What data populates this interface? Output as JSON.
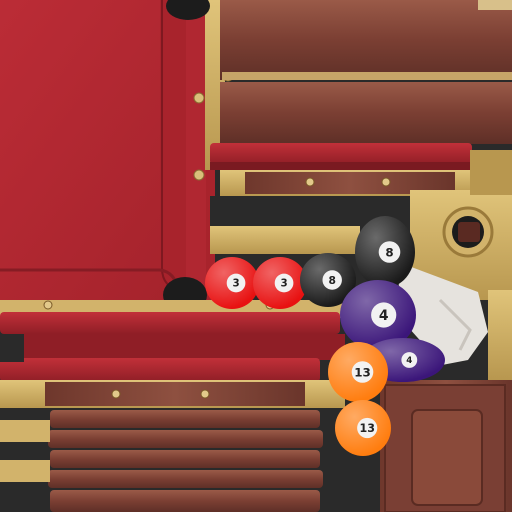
{
  "scene": {
    "kind": "billiards-texture-atlas",
    "colors": {
      "felt": "#b32630",
      "felt_dark": "#8f1e26",
      "wood": "#8a4a3a",
      "wood_dark": "#5e2f27",
      "brass": "#d2b36b",
      "black": "#1c1c1c"
    }
  },
  "balls": [
    {
      "id": "ball-3a",
      "number": "3",
      "color": "#e81111"
    },
    {
      "id": "ball-3b",
      "number": "3",
      "color": "#e81111"
    },
    {
      "id": "ball-8a",
      "number": "8",
      "color": "#1a1a1a"
    },
    {
      "id": "ball-8b",
      "number": "8",
      "color": "#1a1a1a"
    },
    {
      "id": "ball-4a",
      "number": "4",
      "color": "#3b167a"
    },
    {
      "id": "ball-4b",
      "number": "4",
      "color": "#3b167a"
    },
    {
      "id": "ball-13a",
      "number": "13",
      "color": "#ff7d0f"
    },
    {
      "id": "ball-13b",
      "number": "13",
      "color": "#ff7d0f"
    }
  ]
}
